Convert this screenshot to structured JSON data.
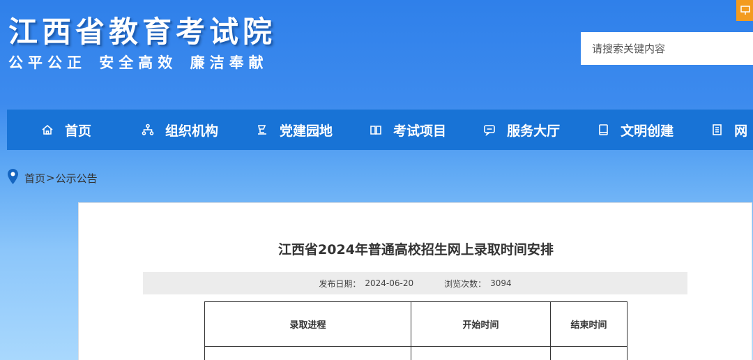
{
  "header": {
    "site_title": "江西省教育考试院",
    "slogan": "公平公正  安全高效  廉洁奉献",
    "search_placeholder": "请搜索关键内容",
    "corner_icon": "monitor-icon"
  },
  "nav": {
    "items": [
      {
        "label": "首页",
        "icon": "home-icon"
      },
      {
        "label": "组织机构",
        "icon": "org-chart-icon"
      },
      {
        "label": "党建园地",
        "icon": "party-building-icon"
      },
      {
        "label": "考试项目",
        "icon": "book-icon"
      },
      {
        "label": "服务大厅",
        "icon": "service-chat-icon"
      },
      {
        "label": "文明创建",
        "icon": "notebook-icon"
      },
      {
        "label": "网",
        "icon": "document-icon"
      }
    ]
  },
  "breadcrumb": {
    "icon": "location-pin-icon",
    "home": "首页",
    "separator": ">",
    "current": "公示公告"
  },
  "article": {
    "title": "江西省2024年普通高校招生网上录取时间安排",
    "publish_label": "发布日期：",
    "publish_date": "2024-06-20",
    "views_label": "浏览次数：",
    "views": "3094",
    "table": {
      "headers": [
        "录取进程",
        "开始时间",
        "结束时间"
      ]
    }
  },
  "colors": {
    "nav_bg": "#1873d6",
    "pin": "#1565c0",
    "corner_btn": "#f39b1f"
  }
}
